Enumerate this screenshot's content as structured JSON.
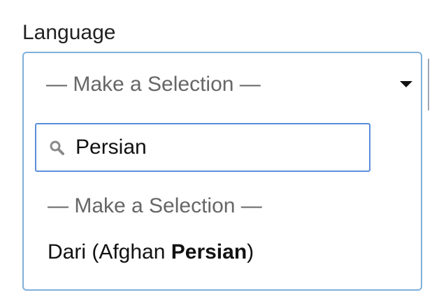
{
  "field": {
    "label": "Language"
  },
  "select": {
    "selected_text": "— Make a Selection —"
  },
  "search": {
    "value": "Persian"
  },
  "options": {
    "placeholder": "— Make a Selection —",
    "result": {
      "before": "Dari (Afghan ",
      "match": "Persian",
      "after": ")"
    }
  },
  "icons": {
    "caret": "caret-down-icon",
    "search": "search-icon"
  },
  "colors": {
    "select_border": "#7fb0da",
    "search_border": "#5b8ed9",
    "placeholder_text": "#666666"
  }
}
